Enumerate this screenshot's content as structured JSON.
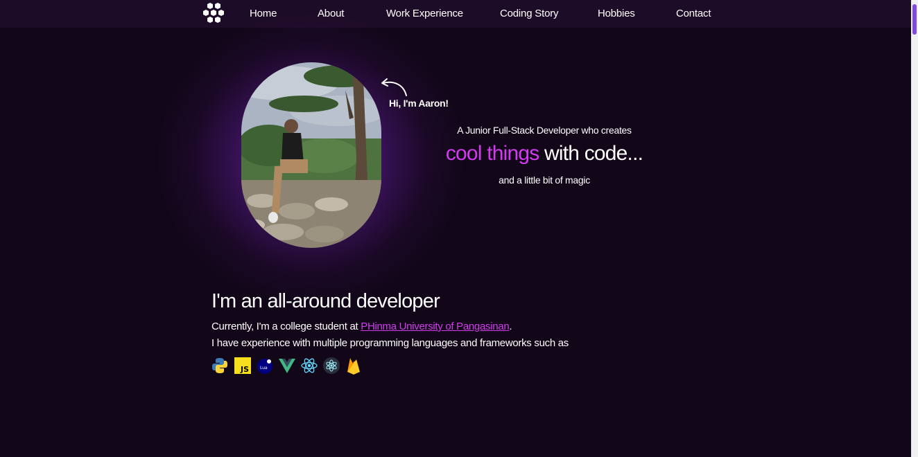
{
  "nav": {
    "logo": "hexagon-cluster-logo",
    "links": [
      {
        "label": "Home"
      },
      {
        "label": "About"
      },
      {
        "label": "Work Experience"
      },
      {
        "label": "Coding Story"
      },
      {
        "label": "Hobbies"
      },
      {
        "label": "Contact"
      }
    ]
  },
  "hero": {
    "greeting": "Hi, I'm Aaron!",
    "tagline_line1": "A Junior Full-Stack Developer who creates",
    "tagline_highlight": "cool things",
    "tagline_rest": " with code...",
    "tagline_line3": "and a little bit of magic"
  },
  "about": {
    "heading": "I'm an all-around developer",
    "line1_prefix": "Currently, I'm a college student at ",
    "university": "PHinma University of Pangasinan",
    "line1_suffix": ".",
    "line2": "I have experience with multiple programming languages and frameworks such as",
    "tech_icons": [
      "python-icon",
      "javascript-icon",
      "lua-icon",
      "vue-icon",
      "react-icon",
      "electron-icon",
      "firebase-icon"
    ]
  },
  "colors": {
    "background": "#120719",
    "navbar": "#1d0c27",
    "accent": "#d43af1",
    "glow": "#8c32d2"
  }
}
